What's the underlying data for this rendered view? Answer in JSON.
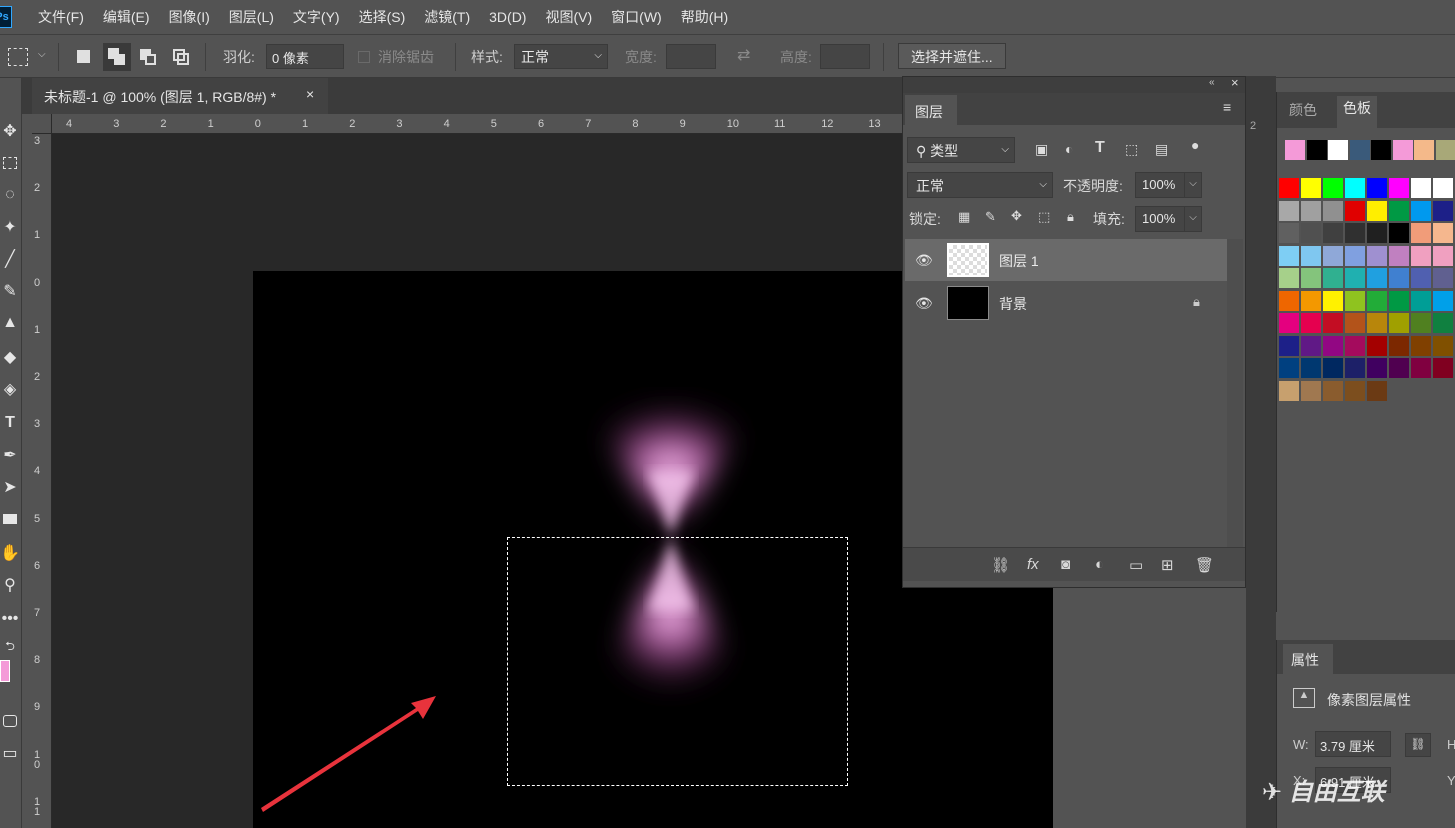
{
  "app": {
    "logo_text": "Ps"
  },
  "menu": [
    "文件(F)",
    "编辑(E)",
    "图像(I)",
    "图层(L)",
    "文字(Y)",
    "选择(S)",
    "滤镜(T)",
    "3D(D)",
    "视图(V)",
    "窗口(W)",
    "帮助(H)"
  ],
  "options_bar": {
    "feather_label": "羽化:",
    "feather_value": "0 像素",
    "antialias_label": "消除锯齿",
    "style_label": "样式:",
    "style_value": "正常",
    "width_label": "宽度:",
    "height_label": "高度:",
    "select_mask_button": "选择并遮住..."
  },
  "document": {
    "tab_title": "未标题-1 @ 100% (图层 1, RGB/8#) *",
    "close_glyph": "×"
  },
  "rulers": {
    "horizontal": [
      "4",
      "3",
      "2",
      "1",
      "0",
      "1",
      "2",
      "3",
      "4",
      "5",
      "6",
      "7",
      "8",
      "9",
      "10",
      "11",
      "12",
      "13"
    ],
    "vertical": [
      "3",
      "2",
      "1",
      "0",
      "1",
      "2",
      "3",
      "4",
      "5",
      "6",
      "7",
      "8",
      "9",
      "1 0",
      "1 1"
    ]
  },
  "layers_panel": {
    "tab": "图层",
    "filter_kind": "类型",
    "blend_mode": "正常",
    "opacity_label": "不透明度:",
    "opacity_value": "100%",
    "lock_label": "锁定:",
    "fill_label": "填充:",
    "fill_value": "100%",
    "layers": [
      {
        "name": "图层 1",
        "selected": true
      },
      {
        "name": "背景",
        "locked": true
      }
    ]
  },
  "swatches_panel": {
    "tabs": [
      "颜色",
      "色板"
    ],
    "recent": [
      "#f49ad8",
      "#000000",
      "#ffffff",
      "#3a5a7a",
      "#000000",
      "#f49ad8",
      "#f4b98a",
      "#a8a878"
    ],
    "grid": [
      [
        "#ff0000",
        "#ffff00",
        "#00ff00",
        "#00ffff",
        "#0000ff",
        "#ff00ff",
        "#ffffff",
        "#ffffff"
      ],
      [
        "#a8a8a8",
        "#a0a0a0",
        "#909090",
        "#e00000",
        "#ffee00",
        "#009944",
        "#0099ee",
        "#1d2088"
      ],
      [
        "#606060",
        "#505050",
        "#404040",
        "#303030",
        "#202020",
        "#000000",
        "#f19c79",
        "#f5b78e"
      ],
      [
        "#7ecef4",
        "#7fc7f0",
        "#8fa8d8",
        "#80a0e0",
        "#9f90d0",
        "#c080c0",
        "#f0a0c0",
        "#f0a0c0"
      ],
      [
        "#a6d08a",
        "#84c47c",
        "#30b090",
        "#20b0b0",
        "#20a0e0",
        "#4080d0",
        "#5060b0",
        "#606090"
      ],
      [
        "#ee6600",
        "#f39800",
        "#fff100",
        "#8fc31f",
        "#22ac38",
        "#009944",
        "#009e96",
        "#00a0e9"
      ],
      [
        "#e4007f",
        "#e5004f",
        "#c30d23",
        "#b3531a",
        "#b8860b",
        "#a0a000",
        "#508020",
        "#108040"
      ],
      [
        "#1d2088",
        "#601986",
        "#920783",
        "#a40b5d",
        "#a40000",
        "#7c2800",
        "#804000",
        "#805000"
      ],
      [
        "#004080",
        "#003870",
        "#002860",
        "#1d2068",
        "#400060",
        "#500050",
        "#800040",
        "#800020"
      ],
      [
        "#c7a06e",
        "#a07850",
        "#8a5c2e",
        "#7c4e1e",
        "#6b3a14"
      ]
    ]
  },
  "properties_panel": {
    "tab": "属性",
    "title": "像素图层属性",
    "w_label": "W:",
    "w_value": "3.79 厘米",
    "x_label": "X:",
    "x_value": "6.91 厘米",
    "h_label": "H",
    "y_label": "Y"
  },
  "colors": {
    "foreground": "#f49ad8",
    "background": "#000000",
    "glow": "#f6a8e6",
    "arrow": "#e8333c"
  },
  "watermark": "自由互联"
}
